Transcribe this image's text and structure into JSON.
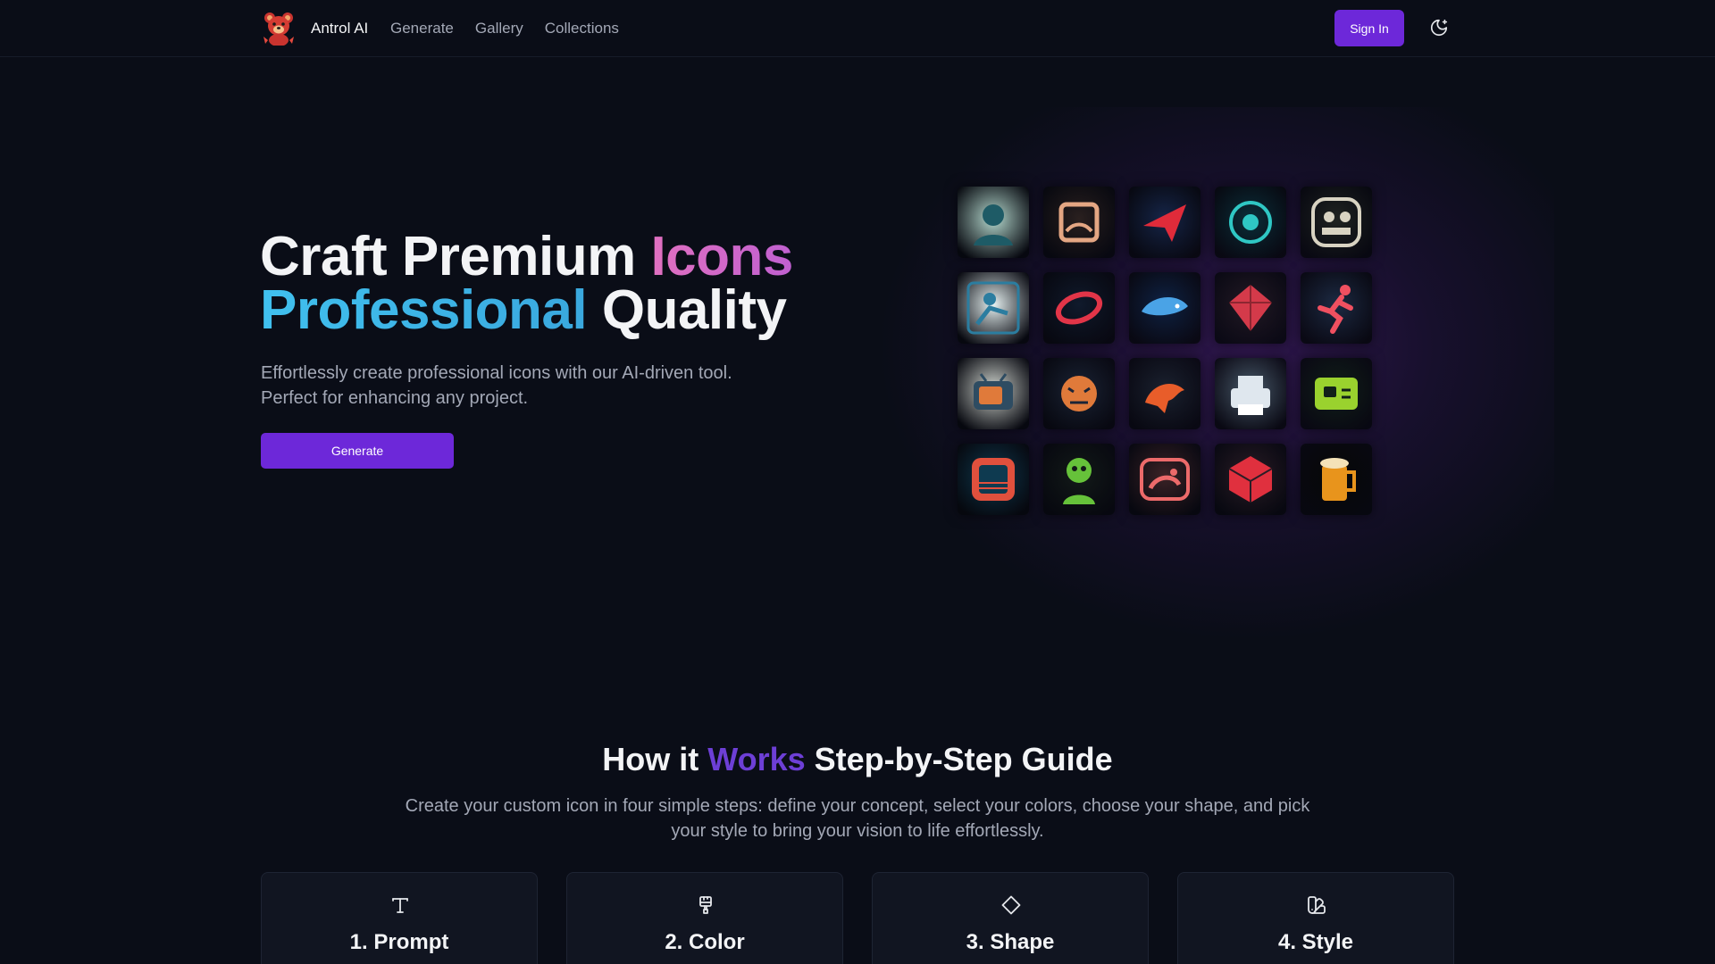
{
  "header": {
    "brand": "Antrol AI",
    "nav": [
      {
        "label": "Generate"
      },
      {
        "label": "Gallery"
      },
      {
        "label": "Collections"
      }
    ],
    "sign_in": "Sign In",
    "theme_icon": "moon-icon"
  },
  "hero": {
    "title_part1": "Craft Premium ",
    "title_part2": "Icons",
    "title_part3": "Professional",
    "title_part4": " Quality",
    "subtitle": "Effortlessly create professional icons with our AI-driven tool. Perfect for enhancing any project.",
    "cta": "Generate"
  },
  "icon_grid": [
    {
      "name": "woman-portrait-icon",
      "bg": "#b8ddd2",
      "fg": "#1e5b66"
    },
    {
      "name": "scroll-icon",
      "bg": "#2a201f",
      "fg": "#e4a683"
    },
    {
      "name": "paper-plane-icon",
      "bg": "#16264a",
      "fg": "#e02b3a"
    },
    {
      "name": "speaker-disc-icon",
      "bg": "#0b2f3a",
      "fg": "#2fc7c4"
    },
    {
      "name": "chess-players-icon",
      "bg": "#202422",
      "fg": "#d8d3c2"
    },
    {
      "name": "typist-icon",
      "bg": "#e9f4f4",
      "fg": "#2b7da0"
    },
    {
      "name": "tech-ring-icon",
      "bg": "#101a2c",
      "fg": "#e23548"
    },
    {
      "name": "orca-icon",
      "bg": "#0f2345",
      "fg": "#4aa3e6"
    },
    {
      "name": "gem-icon",
      "bg": "#231a25",
      "fg": "#d43a4a"
    },
    {
      "name": "runner-icon",
      "bg": "#1d2b44",
      "fg": "#f05060"
    },
    {
      "name": "retro-tv-icon",
      "bg": "#d7dcd5",
      "fg": "#2e4c62"
    },
    {
      "name": "tiger-icon",
      "bg": "#1b2436",
      "fg": "#e07a3a"
    },
    {
      "name": "dragon-icon",
      "bg": "#1b2230",
      "fg": "#e85d2a"
    },
    {
      "name": "printer-icon",
      "bg": "#4a5c6c",
      "fg": "#dfe7ee"
    },
    {
      "name": "card-chip-icon",
      "bg": "#112019",
      "fg": "#9ad22e"
    },
    {
      "name": "window-frame-icon",
      "bg": "#0e3a50",
      "fg": "#e0503d"
    },
    {
      "name": "zombie-icon",
      "bg": "#131a18",
      "fg": "#66c23a"
    },
    {
      "name": "frog-badge-icon",
      "bg": "#3c2326",
      "fg": "#ec6a6a"
    },
    {
      "name": "cube-icon",
      "bg": "#2b1d26",
      "fg": "#e0303e"
    },
    {
      "name": "beer-mug-icon",
      "bg": "#070807",
      "fg": "#e8941c"
    }
  ],
  "guide": {
    "title_part1": "How it ",
    "title_part2": "Works",
    "title_part3": " Step-by-Step Guide",
    "subtitle": "Create your custom icon in four simple steps: define your concept, select your colors, choose your shape, and pick your style to bring your vision to life effortlessly.",
    "steps": [
      {
        "label": "1. Prompt",
        "icon": "text-icon"
      },
      {
        "label": "2. Color",
        "icon": "paintbrush-icon"
      },
      {
        "label": "3. Shape",
        "icon": "diamond-icon"
      },
      {
        "label": "4. Style",
        "icon": "swatch-book-icon"
      }
    ]
  },
  "colors": {
    "background": "#0a0d17",
    "accent": "#6d28d9",
    "title_pink": "#d45cc4",
    "title_cyan": "#3bb4e6",
    "guide_purple": "#6d3fd6"
  }
}
